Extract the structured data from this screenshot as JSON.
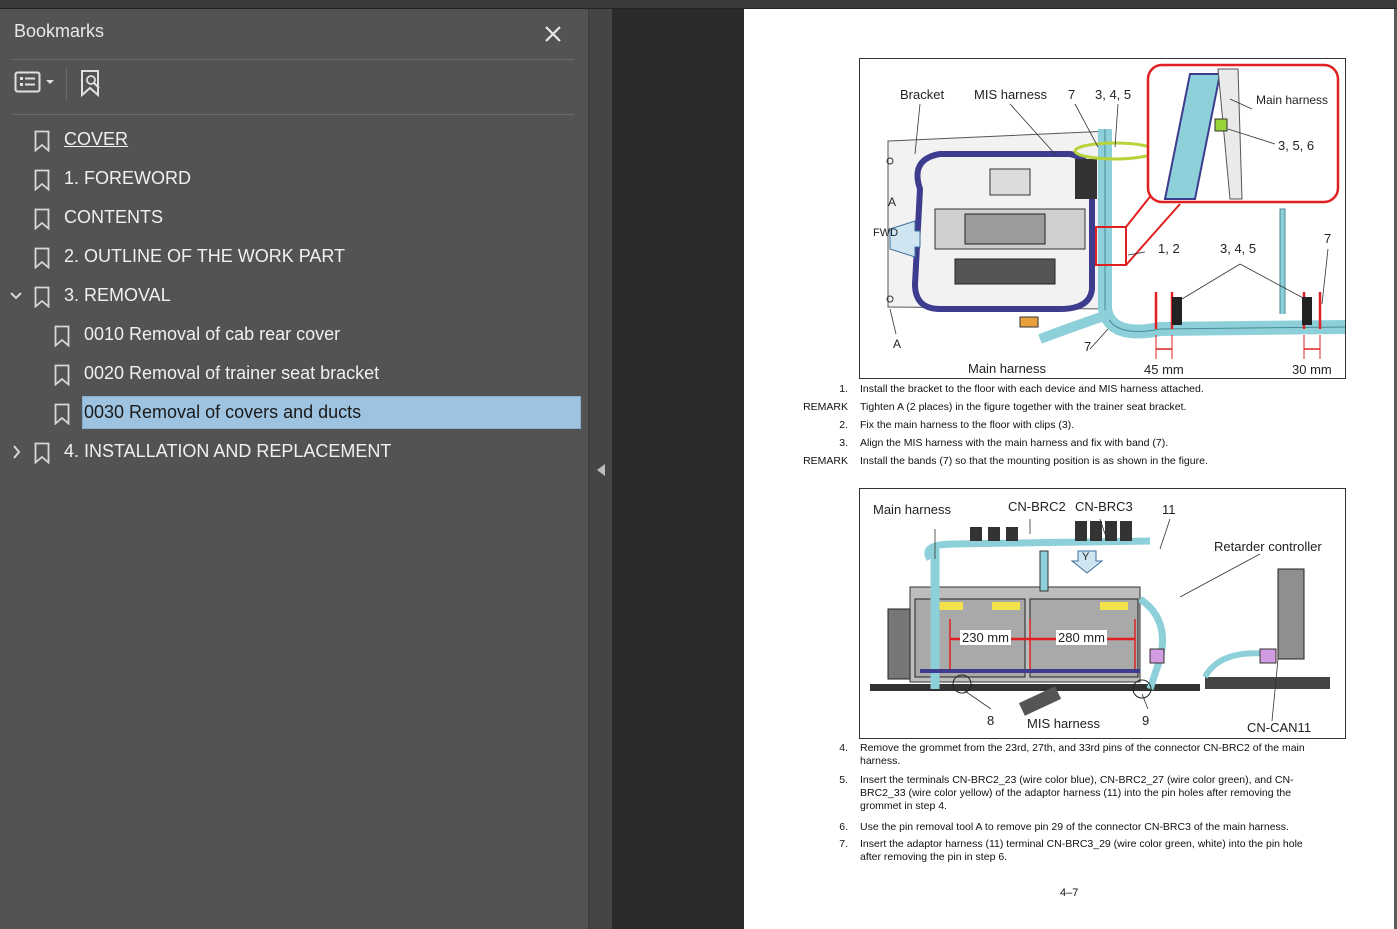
{
  "bookmarks_panel": {
    "title": "Bookmarks",
    "items": [
      {
        "label": "COVER",
        "level": 0,
        "underlined": true
      },
      {
        "label": "1. FOREWORD",
        "level": 0
      },
      {
        "label": "CONTENTS",
        "level": 0
      },
      {
        "label": "2. OUTLINE OF THE WORK PART",
        "level": 0
      },
      {
        "label": "3. REMOVAL",
        "level": 0,
        "expanded": true
      },
      {
        "label": "0010 Removal of cab rear cover",
        "level": 1
      },
      {
        "label": "0020 Removal of trainer seat bracket",
        "level": 1
      },
      {
        "label": "0030 Removal of covers and ducts",
        "level": 1,
        "selected": true
      },
      {
        "label": "4. INSTALLATION AND REPLACEMENT",
        "level": 0,
        "expanded": false
      }
    ]
  },
  "page": {
    "figure1": {
      "labels": {
        "bracket": "Bracket",
        "mis_harness": "MIS harness",
        "num7_top": "7",
        "num345_top": "3, 4, 5",
        "main_harness_callout": "Main harness",
        "num356": "3, 5, 6",
        "a_top": "A",
        "fwd": "FWD",
        "num12": "1, 2",
        "num345_right": "3, 4, 5",
        "num7_right": "7",
        "a_bottom": "A",
        "main_harness_bottom": "Main harness",
        "num7_bottom": "7",
        "dim45": "45 mm",
        "dim30": "30 mm"
      }
    },
    "steps1": [
      {
        "num": "1.",
        "text": "Install the bracket to the floor with each device and MIS harness attached."
      },
      {
        "num": "REMARK",
        "text": "Tighten A (2 places) in the figure together with the trainer seat bracket."
      },
      {
        "num": "2.",
        "text": "Fix the main harness to the floor with clips (3)."
      },
      {
        "num": "3.",
        "text": "Align the MIS harness with the main harness and fix with band (7)."
      },
      {
        "num": "REMARK",
        "text": "Install the bands (7) so that the mounting position is as shown in the figure."
      }
    ],
    "figure2": {
      "labels": {
        "main_harness": "Main harness",
        "cn_brc2": "CN-BRC2",
        "cn_brc3": "CN-BRC3",
        "num11": "11",
        "retarder": "Retarder controller",
        "y": "Y",
        "dim230": "230 mm",
        "dim280": "280 mm",
        "num8": "8",
        "mis_harness": "MIS harness",
        "num9": "9",
        "cn_can11": "CN-CAN11"
      }
    },
    "steps2": [
      {
        "num": "4.",
        "lines": [
          "Remove the grommet from the 23rd, 27th, and 33rd pins of the connector CN-BRC2 of the main",
          "harness."
        ]
      },
      {
        "num": "5.",
        "lines": [
          "Insert the terminals CN-BRC2_23 (wire color blue), CN-BRC2_27 (wire color green), and CN-",
          "BRC2_33 (wire color yellow) of the adaptor harness (11) into the pin holes after removing the",
          "grommet in step 4."
        ]
      },
      {
        "num": "6.",
        "lines": [
          "Use the pin removal tool A to remove pin 29 of the connector CN-BRC3 of the main harness."
        ]
      },
      {
        "num": "7.",
        "lines": [
          "Insert the adaptor harness (11) terminal CN-BRC3_29 (wire color green, white) into the pin hole",
          "after removing the pin in step 6."
        ]
      }
    ],
    "page_number": "4–7"
  }
}
